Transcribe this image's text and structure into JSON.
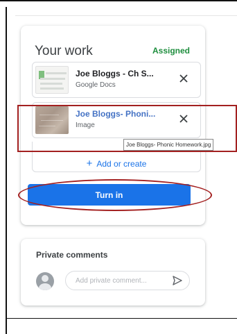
{
  "work": {
    "title": "Your work",
    "status": "Assigned",
    "attachments": [
      {
        "name": "Joe Bloggs - Ch S...",
        "type": "Google Docs",
        "icon": "google-docs-thumbnail"
      },
      {
        "name": "Joe Bloggs- Phoni...",
        "type": "Image",
        "icon": "image-thumbnail"
      }
    ],
    "tooltip": "Joe Bloggs- Phonic Homework.jpg",
    "add_label": "Add or create",
    "turn_in_label": "Turn in"
  },
  "comments": {
    "title": "Private comments",
    "placeholder": "Add private comment..."
  },
  "colors": {
    "accent": "#1a73e8",
    "assigned": "#1e8e3e",
    "annotation": "#a32020",
    "link": "#4472c4"
  }
}
